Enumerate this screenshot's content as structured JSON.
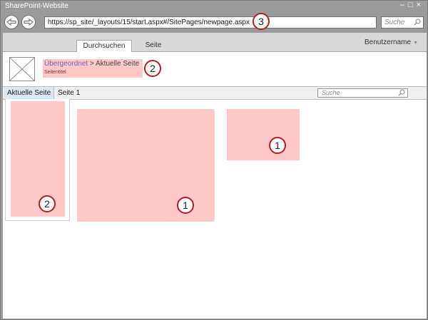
{
  "window": {
    "title": "SharePoint-Website",
    "controls": {
      "minimize": "–",
      "maximize": "□",
      "close": "×"
    }
  },
  "browser": {
    "address": "https://sp_site/_layouts/15/start.aspx#/SitePages/newpage.aspx",
    "search_placeholder": "Suche"
  },
  "ribbon": {
    "tabs": [
      {
        "label": "Durchsuchen",
        "selected": true
      },
      {
        "label": "Seite",
        "selected": false
      }
    ],
    "user": "Benutzername"
  },
  "header": {
    "breadcrumb": {
      "parent": "Übergeordnet",
      "separator": " > ",
      "current": "Aktuelle Seite"
    },
    "page_title": "Seitentitel"
  },
  "topnav": {
    "items": [
      {
        "label": "Aktuelle Seite",
        "selected": true
      },
      {
        "label": "Seite 1",
        "selected": false
      }
    ],
    "search_placeholder": "Suche"
  },
  "callouts": {
    "address": "3",
    "header": "2",
    "left_zone": "2",
    "main_zone": "1",
    "right_zone": "1"
  },
  "colors": {
    "placeholder_zone": "#ffc9c9",
    "callout_ring": "#b31d1d",
    "chrome": "#9b9b9b"
  }
}
